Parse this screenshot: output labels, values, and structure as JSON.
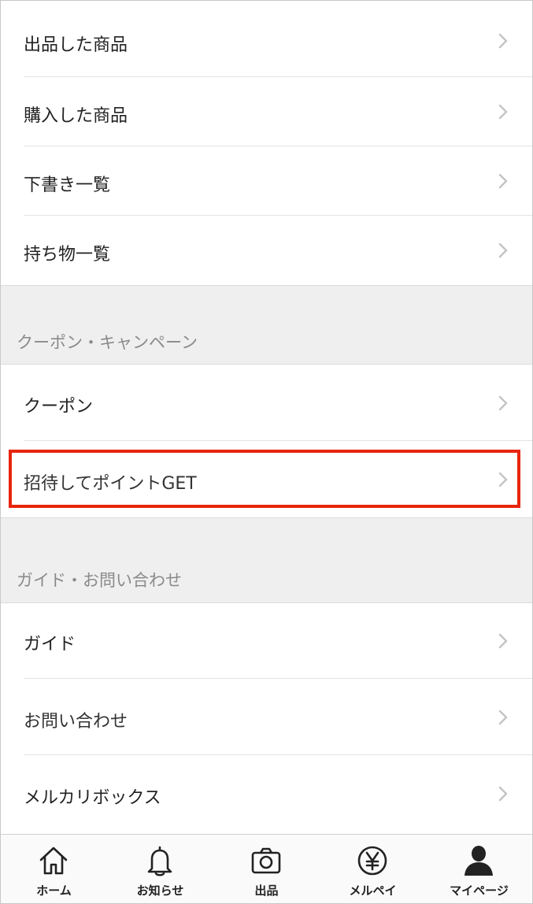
{
  "menu_top": [
    {
      "label": "出品した商品",
      "icon": "chevron-right-icon"
    },
    {
      "label": "購入した商品",
      "icon": "chevron-right-icon"
    },
    {
      "label": "下書き一覧",
      "icon": "chevron-right-icon"
    },
    {
      "label": "持ち物一覧",
      "icon": "chevron-right-icon"
    }
  ],
  "coupon_section": {
    "title": "クーポン・キャンペーン",
    "items": [
      {
        "label": "クーポン"
      },
      {
        "label": "招待してポイントGET",
        "highlighted": true
      }
    ]
  },
  "guide_section": {
    "title": "ガイド・お問い合わせ",
    "items": [
      {
        "label": "ガイド"
      },
      {
        "label": "お問い合わせ"
      },
      {
        "label": "メルカリボックス"
      }
    ]
  },
  "tabbar": [
    {
      "label": "ホーム",
      "icon": "home-icon"
    },
    {
      "label": "お知らせ",
      "icon": "bell-icon"
    },
    {
      "label": "出品",
      "icon": "camera-icon"
    },
    {
      "label": "メルペイ",
      "icon": "yen-icon"
    },
    {
      "label": "マイページ",
      "icon": "person-icon",
      "active": true
    }
  ],
  "colors": {
    "highlight_border": "#e8260d",
    "section_background": "#efefef",
    "chevron": "#c4c4c4"
  }
}
